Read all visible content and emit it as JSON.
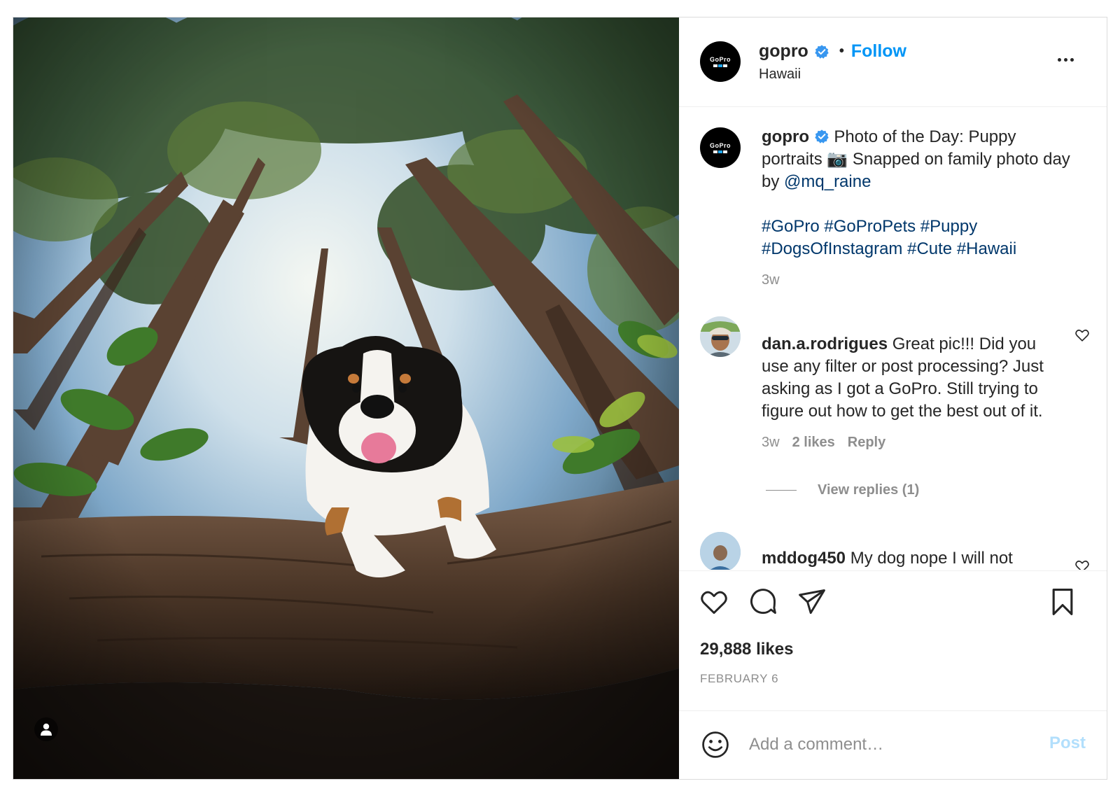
{
  "header": {
    "username": "gopro",
    "separator": "•",
    "follow_label": "Follow",
    "location": "Hawaii",
    "avatar_logo": "GoPro"
  },
  "caption": {
    "username": "gopro",
    "text_1": "Photo of the Day: Puppy portraits 📷 Snapped on family photo day by ",
    "mention": "@mq_raine",
    "hashtags": [
      "#GoPro",
      "#GoProPets",
      "#Puppy",
      "#DogsOfInstagram",
      "#Cute",
      "#Hawaii"
    ],
    "time": "3w"
  },
  "comments": [
    {
      "username": "dan.a.rodrigues",
      "text": "Great pic!!! Did you use any filter or post processing? Just asking as I got a GoPro. Still trying to figure out how to get the best out of it.",
      "time": "3w",
      "likes": "2 likes",
      "reply_label": "Reply",
      "view_replies": "View replies (1)"
    },
    {
      "username": "mddog450",
      "text": "My dog nope I will not"
    }
  ],
  "actions": {
    "like_icon": "heart-icon",
    "comment_icon": "comment-bubble-icon",
    "share_icon": "paper-plane-icon",
    "save_icon": "bookmark-icon",
    "likes_count": "29,888 likes",
    "date": "FEBRUARY 6"
  },
  "composer": {
    "emoji_icon": "smiley-icon",
    "placeholder": "Add a comment…",
    "post_label": "Post"
  },
  "colors": {
    "accent": "#0095f6",
    "link": "#00376b",
    "muted": "#8e8e8e",
    "post_disabled": "#b2dffc"
  }
}
